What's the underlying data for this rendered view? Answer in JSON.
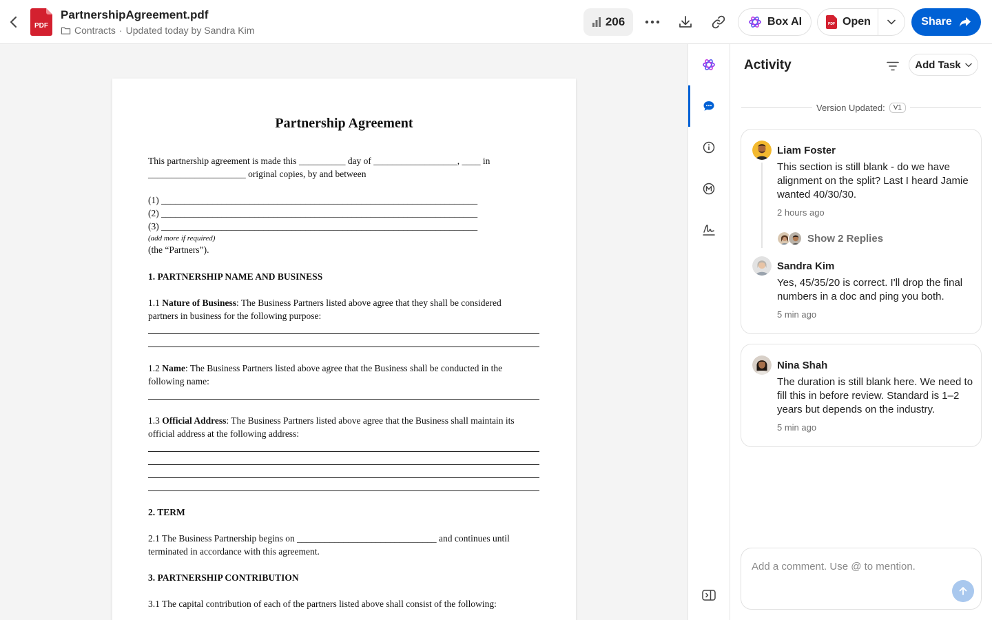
{
  "header": {
    "file_name": "PartnershipAgreement.pdf",
    "folder": "Contracts",
    "separator": "·",
    "updated": "Updated today by Sandra Kim",
    "file_type_badge": "PDF",
    "views_count": "206",
    "box_ai_label": "Box AI",
    "open_label": "Open",
    "open_badge": "PDF",
    "share_label": "Share",
    "icons": [
      "back-chevron-icon",
      "pdf-file-icon",
      "folder-icon",
      "bar-chart-icon",
      "more-icon",
      "download-icon",
      "link-icon",
      "box-ai-icon",
      "chevron-down-icon",
      "share-arrow-icon"
    ]
  },
  "document": {
    "title": "Partnership Agreement",
    "intro_1": "This partnership agreement is made this __________ day of __________________, ____ in",
    "intro_2": "_____________________ original copies, by and between",
    "party_1": "(1) ____________________________________________________________________",
    "party_2": "(2) ____________________________________________________________________",
    "party_3": "(3) ____________________________________________________________________",
    "add_more": "(add more if required)",
    "partners": "(the “Partners”).",
    "section_1": "1. PARTNERSHIP NAME AND BUSINESS",
    "s11_num": "1.1 ",
    "s11_bold": "Nature of Business",
    "s11_rest": ": The Business Partners listed above agree that they shall be considered",
    "s11_line2": "partners in business for the following purpose:",
    "s12_num": "1.2 ",
    "s12_bold": "Name",
    "s12_rest": ": The Business Partners listed above agree that the Business shall be conducted in the",
    "s12_line2": "following name:",
    "s13_num": "1.3 ",
    "s13_bold": "Official Address",
    "s13_rest": ": The Business Partners listed above agree that the Business shall maintain its",
    "s13_line2": "official address at the following address:",
    "section_2": "2. TERM",
    "s21_line1": "2.1 The Business Partnership begins on ______________________________ and continues until",
    "s21_line2": "terminated in accordance with this agreement.",
    "section_3": "3. PARTNERSHIP CONTRIBUTION",
    "s31_line1": "3.1 The capital contribution of each of the partners listed above shall consist of the following:"
  },
  "rail": {
    "items": [
      "box-ai-icon",
      "comment-icon",
      "info-icon",
      "metadata-icon",
      "sign-icon"
    ],
    "active": "comment-icon",
    "bottom": "collapse-panel-icon"
  },
  "activity": {
    "title": "Activity",
    "add_task_label": "Add Task",
    "version_label": "Version Updated:",
    "version_badge": "V1",
    "comment_1": {
      "author": "Liam Foster",
      "text": "This section is still blank - do we have alignment on the split? Last I heard Jamie wanted 40/30/30.",
      "time": "2 hours ago",
      "replies_label": "Show 2 Replies"
    },
    "reply_1": {
      "author": "Sandra Kim",
      "text": "Yes, 45/35/20 is correct. I'll drop the final numbers in a doc and ping you both.",
      "time": "5 min ago"
    },
    "comment_2": {
      "author": "Nina Shah",
      "text": "The duration is still blank here. We need to fill this in before review. Standard is 1–2 years but depends on the industry.",
      "time": "5 min ago"
    },
    "comment_placeholder": "Add a comment. Use @ to mention."
  },
  "colors": {
    "accent": "#0061d5",
    "pdf_red": "#d3202f",
    "box_ai_purple": "#8b3cf0",
    "send_disabled": "#a9c8ee"
  }
}
